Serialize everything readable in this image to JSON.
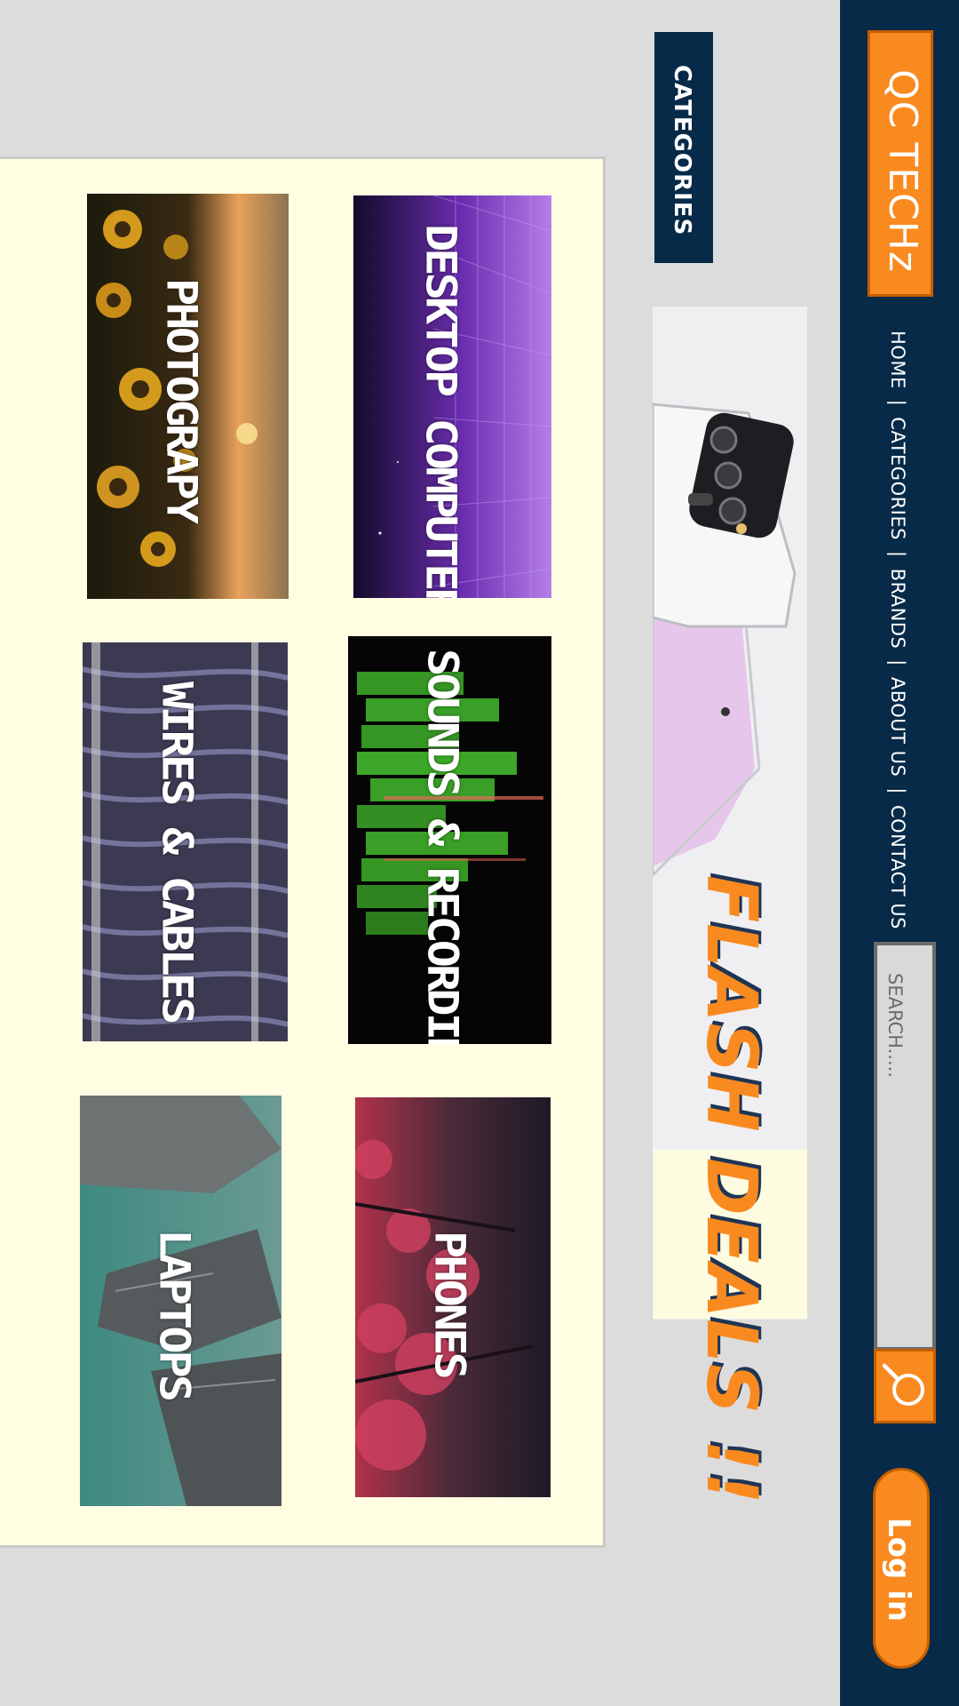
{
  "brand": {
    "name": "QC TECHz",
    "accent": "#f98a20",
    "navy": "#062a47"
  },
  "nav": {
    "links": [
      "HOME",
      "CATEGORIES",
      "BRANDS",
      "ABOUT US",
      "CONTACT US"
    ],
    "separator": "|"
  },
  "search": {
    "placeholder": "SEARCH.....",
    "icon": "search-icon"
  },
  "login": {
    "label": "Log in"
  },
  "categories_heading": "CATEGORIES",
  "banner": {
    "text": "FLASH DEALS !!"
  },
  "categories": [
    {
      "label": "DESKTOP COMPUTER"
    },
    {
      "label": "PHOTOGRAPY"
    },
    {
      "label": "SOUNDS & RECORDING"
    },
    {
      "label": "WIRES & CABLES"
    },
    {
      "label": "PHONES"
    },
    {
      "label": "LAPTOPS"
    }
  ]
}
